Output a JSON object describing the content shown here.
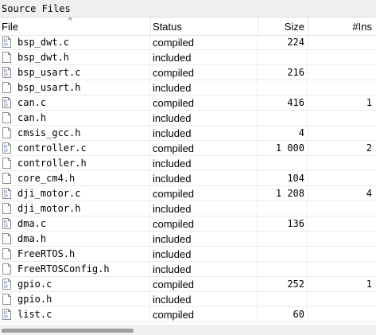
{
  "panel": {
    "title": "Source Files"
  },
  "columns": {
    "file": "File",
    "status": "Status",
    "size": "Size",
    "ins": "#Ins"
  },
  "rows": [
    {
      "file": "bsp_dwt.c",
      "status": "compiled",
      "size": "224",
      "ins": "",
      "icon": "source-file-icon"
    },
    {
      "file": "bsp_dwt.h",
      "status": "included",
      "size": "",
      "ins": "",
      "icon": "header-file-icon"
    },
    {
      "file": "bsp_usart.c",
      "status": "compiled",
      "size": "216",
      "ins": "",
      "icon": "source-file-icon"
    },
    {
      "file": "bsp_usart.h",
      "status": "included",
      "size": "",
      "ins": "",
      "icon": "header-file-icon"
    },
    {
      "file": "can.c",
      "status": "compiled",
      "size": "416",
      "ins": "1",
      "icon": "source-file-icon"
    },
    {
      "file": "can.h",
      "status": "included",
      "size": "",
      "ins": "",
      "icon": "header-file-icon"
    },
    {
      "file": "cmsis_gcc.h",
      "status": "included",
      "size": "4",
      "ins": "",
      "icon": "header-file-icon"
    },
    {
      "file": "controller.c",
      "status": "compiled",
      "size": "1 000",
      "ins": "2",
      "icon": "source-file-icon"
    },
    {
      "file": "controller.h",
      "status": "included",
      "size": "",
      "ins": "",
      "icon": "header-file-icon"
    },
    {
      "file": "core_cm4.h",
      "status": "included",
      "size": "104",
      "ins": "",
      "icon": "header-file-icon"
    },
    {
      "file": "dji_motor.c",
      "status": "compiled",
      "size": "1 208",
      "ins": "4",
      "icon": "source-file-icon"
    },
    {
      "file": "dji_motor.h",
      "status": "included",
      "size": "",
      "ins": "",
      "icon": "header-file-icon"
    },
    {
      "file": "dma.c",
      "status": "compiled",
      "size": "136",
      "ins": "",
      "icon": "source-file-icon"
    },
    {
      "file": "dma.h",
      "status": "included",
      "size": "",
      "ins": "",
      "icon": "header-file-icon"
    },
    {
      "file": "FreeRTOS.h",
      "status": "included",
      "size": "",
      "ins": "",
      "icon": "header-file-icon"
    },
    {
      "file": "FreeRTOSConfig.h",
      "status": "included",
      "size": "",
      "ins": "",
      "icon": "header-file-icon"
    },
    {
      "file": "gpio.c",
      "status": "compiled",
      "size": "252",
      "ins": "1",
      "icon": "source-file-icon"
    },
    {
      "file": "gpio.h",
      "status": "included",
      "size": "",
      "ins": "",
      "icon": "header-file-icon"
    },
    {
      "file": "list.c",
      "status": "compiled",
      "size": "60",
      "ins": "",
      "icon": "source-file-icon"
    }
  ]
}
